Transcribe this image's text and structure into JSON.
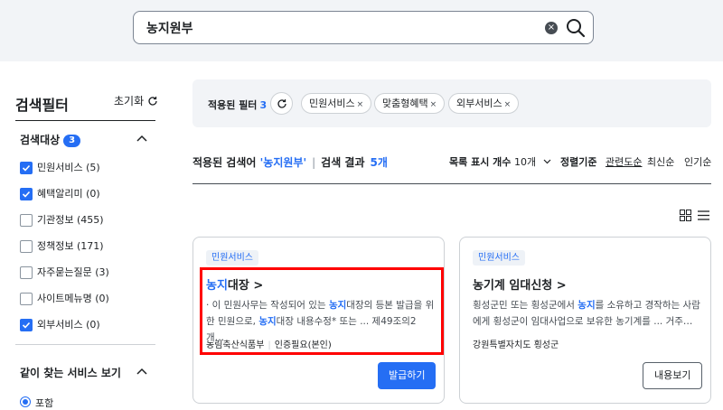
{
  "search": {
    "value": "농지원부",
    "clear_symbol": "×"
  },
  "sidebar": {
    "title": "검색필터",
    "reset_label": "초기화",
    "target_section": {
      "title": "검색대상",
      "count": "3"
    },
    "checkboxes": [
      {
        "label": "민원서비스 (5)",
        "checked": true
      },
      {
        "label": "혜택알리미 (0)",
        "checked": true
      },
      {
        "label": "기관정보 (455)",
        "checked": false
      },
      {
        "label": "정책정보 (171)",
        "checked": false
      },
      {
        "label": "자주묻는질문 (3)",
        "checked": false
      },
      {
        "label": "사이트메뉴명 (0)",
        "checked": false
      },
      {
        "label": "외부서비스 (0)",
        "checked": true
      }
    ],
    "related_section": {
      "title": "같이 찾는 서비스 보기"
    },
    "radio_label": "포함"
  },
  "applied_filters": {
    "label": "적용된 필터",
    "count": "3",
    "chips": [
      "민원서비스",
      "맞춤형혜택",
      "외부서비스"
    ],
    "chip_remove": "×"
  },
  "results": {
    "prefix": "적용된 검색어",
    "query": "'농지원부'",
    "result_label": "검색 결과",
    "count": "5개",
    "list_count_label": "목록 표시 개수",
    "list_count_value": "10개",
    "sort_label": "정렬기준",
    "sort_options": [
      "관련도순",
      "최신순",
      "인기순"
    ]
  },
  "cards": [
    {
      "tag": "민원서비스",
      "title_hl": "농지",
      "title_rest": "대장 >",
      "desc_parts": [
        "· 이 민원사무는 작성되어 있는 ",
        "농지",
        "대장의 등본 발급을 위한 민원으로, ",
        "농지",
        "대장 내용수정* 또는 ... 제49조의2 개…"
      ],
      "org": "농림축산식품부",
      "auth": "인증필요(본인)",
      "button": "발급하기"
    },
    {
      "tag": "민원서비스",
      "title": "농기계 임대신청 >",
      "desc_parts": [
        "횡성군민 또는 횡성군에서 ",
        "농지",
        "를 소유하고 경작하는 사람에게 횡성군이 임대사업으로 보유한 농기계를 ... 거주…"
      ],
      "org": "강원특별자치도 횡성군",
      "button": "내용보기"
    }
  ]
}
